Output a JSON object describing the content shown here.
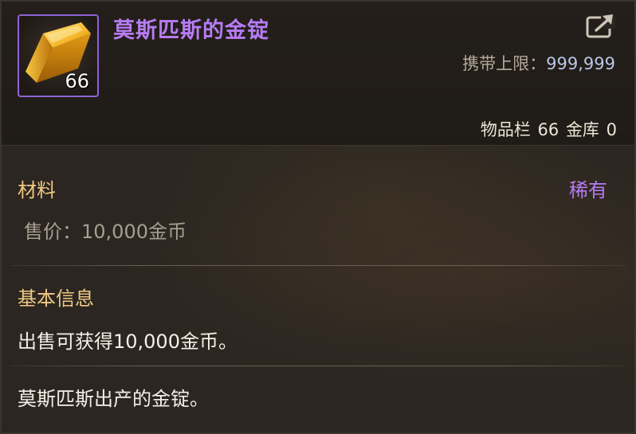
{
  "item": {
    "name": "莫斯匹斯的金锭",
    "icon": "gold-ingot-icon",
    "stack_count": "66",
    "rarity": "稀有",
    "category": "材料",
    "price_label": "售价：",
    "price_value": "10,000金币"
  },
  "carry_limit": {
    "label": "携带上限：",
    "value": "999,999"
  },
  "storage": {
    "inventory_label": "物品栏",
    "inventory_count": "66",
    "vault_label": "金库",
    "vault_count": "0"
  },
  "basic_info": {
    "title": "基本信息",
    "text": "出售可获得10,000金币。"
  },
  "description": "莫斯匹斯出产的金锭。",
  "colors": {
    "rarity": "#b67cf2",
    "section_title": "#f1c982",
    "limit_value": "#b9c6e6"
  },
  "share_icon": "share-export-icon"
}
